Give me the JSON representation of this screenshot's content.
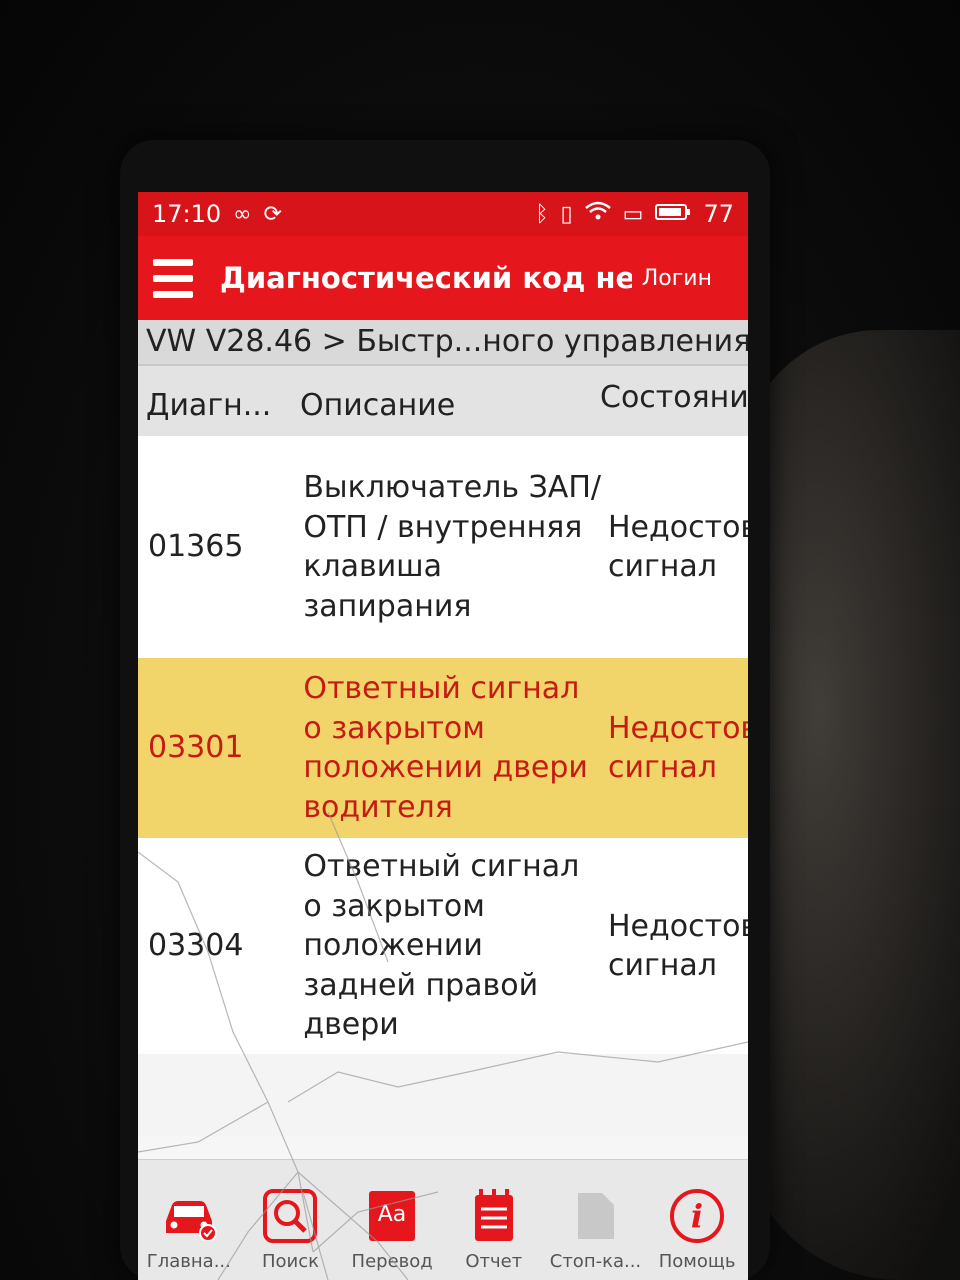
{
  "status_bar": {
    "time": "17:10",
    "battery": "77",
    "icons": [
      "infinity-icon",
      "sync-icon",
      "bluetooth-icon",
      "vibrate-icon",
      "wifi-icon",
      "tablet-icon",
      "battery-icon"
    ]
  },
  "app_bar": {
    "title": "Диагностический код не...",
    "login_label": "Логин"
  },
  "breadcrumb": "VW V28.46 > Быстр...ного управления",
  "table": {
    "headers": {
      "code": "Диагн...",
      "description": "Описание",
      "state": "Состояние"
    },
    "rows": [
      {
        "code": "01365",
        "description": "Выключатель ЗАП/ОТП / внутренняя клавиша запирания",
        "state": "Недостоверный сигнал",
        "highlighted": false
      },
      {
        "code": "03301",
        "description": "Ответный сигнал о закрытом положении двери водителя",
        "state": "Недостоверный сигнал",
        "highlighted": true
      },
      {
        "code": "03304",
        "description": "Ответный сигнал о закрытом положении задней правой двери",
        "state": "Недостоверный сигнал",
        "highlighted": false
      }
    ]
  },
  "bottom_nav": [
    {
      "label": "Главна...",
      "icon": "car-check-icon"
    },
    {
      "label": "Поиск",
      "icon": "search-icon"
    },
    {
      "label": "Перевод",
      "icon": "translate-icon"
    },
    {
      "label": "Отчет",
      "icon": "report-icon"
    },
    {
      "label": "Стоп-ка...",
      "icon": "freeze-frame-icon"
    },
    {
      "label": "Помощь",
      "icon": "help-icon"
    }
  ],
  "colors": {
    "accent": "#e5161c",
    "highlight_row": "#f2d56a",
    "highlight_text": "#c41b12"
  }
}
